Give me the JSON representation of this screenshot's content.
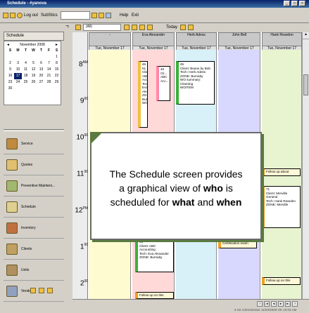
{
  "window": {
    "title": "Schedule - #yanova",
    "min": "_",
    "max": "□",
    "close": "×"
  },
  "toolbar": {
    "logout": "Log out",
    "substitute": "SubStics",
    "help": "Help",
    "exit": "Exit",
    "filter_value": "(All)",
    "today": "Today",
    "pin": "ㄱ"
  },
  "sidebar": {
    "schedule_header": "Schedule",
    "calendar": {
      "month": "November",
      "year": "2008",
      "days_header": [
        "S",
        "M",
        "T",
        "W",
        "T",
        "F",
        "S"
      ],
      "weeks": [
        [
          "",
          "",
          "",
          "",
          "",
          "",
          "1"
        ],
        [
          "2",
          "3",
          "4",
          "5",
          "6",
          "7",
          "8"
        ],
        [
          "9",
          "10",
          "11",
          "12",
          "13",
          "14",
          "15"
        ],
        [
          "16",
          "17",
          "18",
          "19",
          "20",
          "21",
          "22"
        ],
        [
          "23",
          "24",
          "25",
          "26",
          "27",
          "28",
          "29"
        ],
        [
          "30",
          "",
          "",
          "",
          "",
          "",
          ""
        ]
      ]
    },
    "nav": [
      "Service",
      "Quotes",
      "Preventive Mainteni...",
      "Schedule",
      "Inventory",
      "Clients",
      "Units",
      "Vendors"
    ]
  },
  "schedule": {
    "columns": [
      {
        "name": "-",
        "date": "Tue, November 17"
      },
      {
        "name": "Eva Alexander",
        "date": "Tue, November 17"
      },
      {
        "name": "Herb Adess",
        "date": "Tue, November 17"
      },
      {
        "name": "John Bell",
        "date": "Tue, November 17"
      },
      {
        "name": "Hank Reardon",
        "date": "Tue, November 17"
      }
    ],
    "hours": [
      {
        "h": "8",
        "ap": "AM"
      },
      {
        "h": "9",
        "ap": "00"
      },
      {
        "h": "10",
        "ap": "00"
      },
      {
        "h": "11",
        "ap": "00"
      },
      {
        "h": "12",
        "ap": "PM"
      },
      {
        "h": "1",
        "ap": "00"
      },
      {
        "h": "2",
        "ap": "00"
      }
    ],
    "appts": {
      "eva1": "46\n51\nClie\nABC\nAcc...\nTech\nEva\nAle...\nZO...\nBur...\nWO",
      "eva2": "46\nCli...\nABC\nAcc...",
      "herb": "45\nClient: Beans by Bob\nTech: Herb Adess\nZONE: Burnaby\nWO summary: Cleaning\nWOITEM",
      "hank1": "Follow up about",
      "hank2": "71\nClient: Merville General\nTech: Hank Rearden\nZONE: Merville",
      "eva3": "43\nClient: ABC Accounting\nTech: Eva Alexander\nZONE: Burnaby",
      "herb2": "Certification exam",
      "hank3": "Follow up on this",
      "eva4": "Follow up on this"
    },
    "callout": {
      "line1": "The Schedule screen provides",
      "line2a": "a graphical view of ",
      "who": "who",
      "line2b": " is",
      "line3a": "scheduled for ",
      "what": "what",
      "and": " and ",
      "when": "when"
    },
    "status": "6 ISI Administrator   11/03/2009 OK 10:03 AM",
    "pager": [
      "?",
      "|◄",
      "◄",
      "►",
      "►|",
      "?"
    ]
  }
}
